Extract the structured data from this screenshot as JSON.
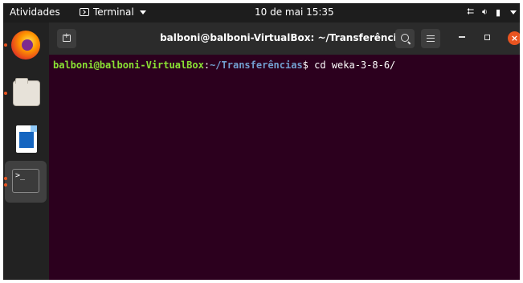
{
  "topbar": {
    "activities": "Atividades",
    "app_menu": "Terminal",
    "clock": "10 de mai  15:35",
    "tray_network": "network-icon",
    "tray_volume": "volume-icon",
    "tray_battery": "battery-icon"
  },
  "dock": {
    "items": [
      "Firefox",
      "Files",
      "LibreOffice Writer",
      "Terminal"
    ]
  },
  "window": {
    "title": "balboni@balboni-VirtualBox: ~/Transferências"
  },
  "terminal": {
    "prompt_user": "balboni@balboni-VirtualBox",
    "prompt_sep": ":",
    "prompt_path": "~/Transferências",
    "prompt_end": "$",
    "command": " cd weka-3-8-6/"
  },
  "colors": {
    "terminal_bg": "#2c001e",
    "prompt_user": "#8ae234",
    "prompt_path": "#729fcf",
    "accent": "#e95420"
  }
}
